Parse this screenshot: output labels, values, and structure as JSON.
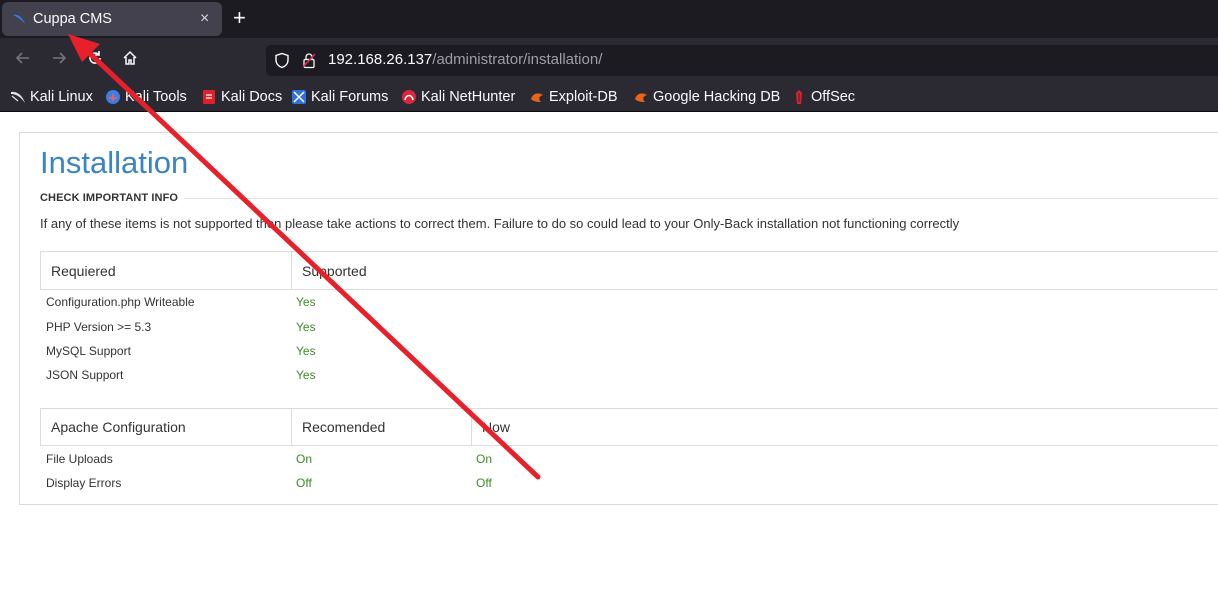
{
  "browser": {
    "tab": {
      "title": "Cuppa CMS",
      "close_glyph": "×",
      "favicon": "kali-dragon-icon"
    },
    "new_tab_glyph": "+",
    "url": {
      "host": "192.168.26.137",
      "path": "/administrator/installation/"
    },
    "bookmarks": [
      {
        "label": "Kali Linux",
        "icon": "kali-icon"
      },
      {
        "label": "Kali Tools",
        "icon": "kali-tools-icon"
      },
      {
        "label": "Kali Docs",
        "icon": "kali-docs-icon"
      },
      {
        "label": "Kali Forums",
        "icon": "kali-forums-icon"
      },
      {
        "label": "Kali NetHunter",
        "icon": "nethunter-icon"
      },
      {
        "label": "Exploit-DB",
        "icon": "exploit-db-icon"
      },
      {
        "label": "Google Hacking DB",
        "icon": "ghdb-icon"
      },
      {
        "label": "OffSec",
        "icon": "offsec-icon"
      }
    ]
  },
  "page": {
    "title": "Installation",
    "subtitle": "CHECK IMPORTANT INFO",
    "info": "If any of these items is not supported then please take actions to correct them. Failure to do so could lead to your Only-Back installation not functioning correctly",
    "requirements": {
      "headers": [
        "Requiered",
        "Supported"
      ],
      "rows": [
        {
          "label": "Configuration.php Writeable",
          "value": "Yes"
        },
        {
          "label": "PHP Version >= 5.3",
          "value": "Yes"
        },
        {
          "label": "MySQL Support",
          "value": "Yes"
        },
        {
          "label": "JSON Support",
          "value": "Yes"
        }
      ]
    },
    "apache": {
      "headers": [
        "Apache Configuration",
        "Recomended",
        "Now"
      ],
      "rows": [
        {
          "label": "File Uploads",
          "recommended": "On",
          "now": "On"
        },
        {
          "label": "Display Errors",
          "recommended": "Off",
          "now": "Off"
        }
      ]
    }
  },
  "colors": {
    "title": "#3a84c6",
    "ok": "#3d8b25",
    "annotation_arrow": "#e8202a"
  }
}
